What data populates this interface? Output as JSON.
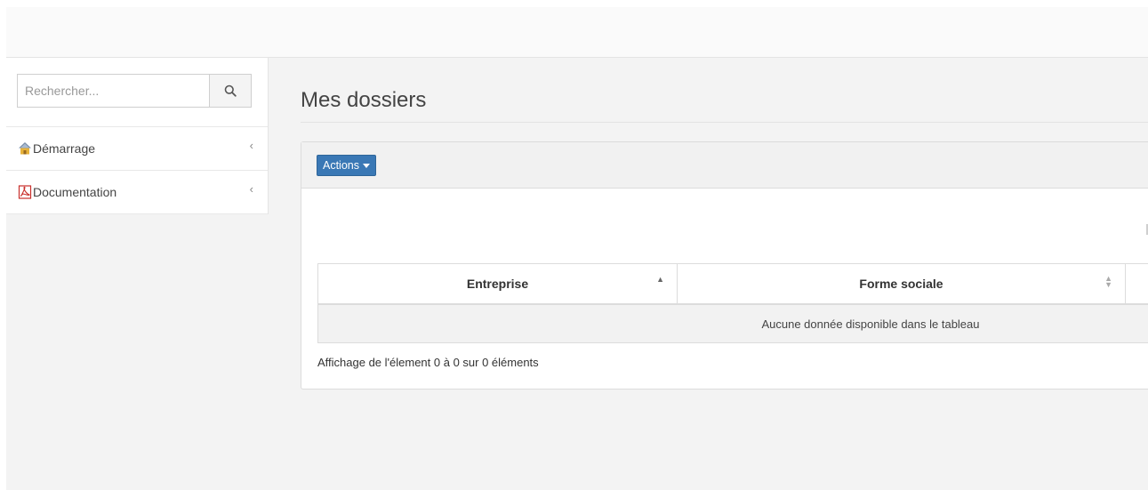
{
  "search": {
    "placeholder": "Rechercher...",
    "icon": "search-icon"
  },
  "sidebar": {
    "items": [
      {
        "label": "Démarrage",
        "icon": "house-icon",
        "chevron": "‹"
      },
      {
        "label": "Documentation",
        "icon": "pdf-icon",
        "chevron": "‹"
      }
    ]
  },
  "main": {
    "title": "Mes dossiers",
    "actions_label": "Actions",
    "table": {
      "columns": [
        {
          "label": "Entreprise",
          "sort": "asc"
        },
        {
          "label": "Forme sociale",
          "sort": "both"
        }
      ],
      "empty_message": "Aucune donnée disponible dans le tableau"
    },
    "info": "Affichage de l'élement 0 à 0 sur 0 éléments"
  },
  "colors": {
    "primary": "#3a78b5",
    "background": "#f3f3f3",
    "border": "#dcdcdc"
  }
}
